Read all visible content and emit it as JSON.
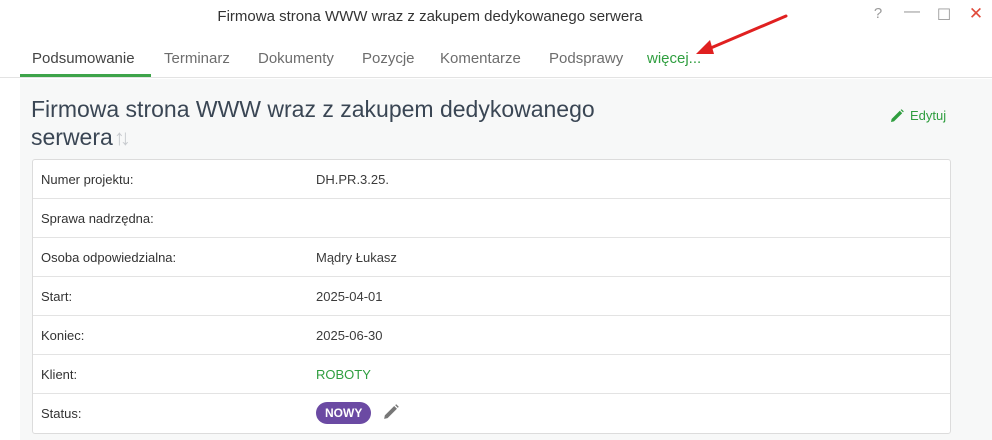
{
  "window": {
    "title": "Firmowa strona WWW wraz z zakupem dedykowanego serwera",
    "help_icon": "?",
    "minimize_icon": "—",
    "maximize_icon": "☐",
    "close_icon": "✕"
  },
  "tabs": [
    {
      "label": "Podsumowanie",
      "active": true
    },
    {
      "label": "Terminarz"
    },
    {
      "label": "Dokumenty"
    },
    {
      "label": "Pozycje"
    },
    {
      "label": "Komentarze"
    },
    {
      "label": "Podsprawy"
    },
    {
      "label": "więcej..."
    }
  ],
  "main": {
    "title": "Firmowa strona WWW wraz z zakupem dedykowanego serwera",
    "sort_icon": "↑↓",
    "edit_label": "Edytuj"
  },
  "details": {
    "project_number": {
      "label": "Numer projektu:",
      "value": "DH.PR.3.25."
    },
    "parent_case": {
      "label": "Sprawa nadrzędna:",
      "value": ""
    },
    "responsible": {
      "label": "Osoba odpowiedzialna:",
      "value": "Mądry Łukasz"
    },
    "start": {
      "label": "Start:",
      "value": "2025-04-01"
    },
    "end": {
      "label": "Koniec:",
      "value": "2025-06-30"
    },
    "client": {
      "label": "Klient:",
      "value": "ROBOTY"
    },
    "status": {
      "label": "Status:",
      "value": "NOWY"
    }
  },
  "colors": {
    "accent_green": "#2f9e3f",
    "status_badge": "#6b4aa3",
    "annotation_arrow": "#e02020",
    "close_button": "#e04b3b"
  }
}
